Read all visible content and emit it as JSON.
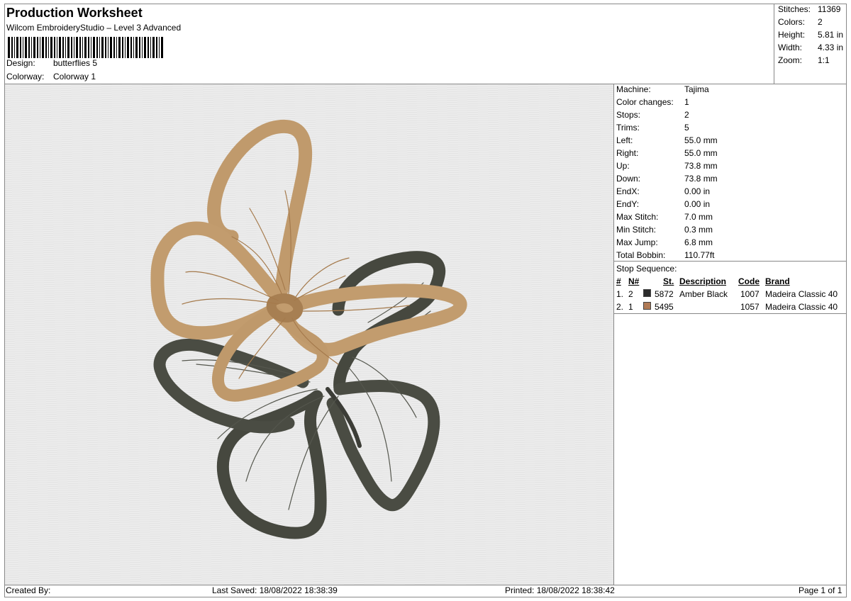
{
  "header": {
    "title": "Production Worksheet",
    "subtitle": "Wilcom EmbroideryStudio – Level 3 Advanced",
    "design_label": "Design:",
    "design_value": "butterflies 5",
    "colorway_label": "Colorway:",
    "colorway_value": "Colorway 1"
  },
  "stats": [
    {
      "label": "Stitches:",
      "value": "11369"
    },
    {
      "label": "Colors:",
      "value": "2"
    },
    {
      "label": "Height:",
      "value": "5.81 in"
    },
    {
      "label": "Width:",
      "value": "4.33 in"
    },
    {
      "label": "Zoom:",
      "value": "1:1"
    }
  ],
  "machine_info": [
    {
      "label": "Machine:",
      "value": "Tajima"
    },
    {
      "label": "Color changes:",
      "value": "1"
    },
    {
      "label": "Stops:",
      "value": "2"
    },
    {
      "label": "Trims:",
      "value": "5"
    },
    {
      "label": "Left:",
      "value": "55.0 mm"
    },
    {
      "label": "Right:",
      "value": "55.0 mm"
    },
    {
      "label": "Up:",
      "value": "73.8 mm"
    },
    {
      "label": "Down:",
      "value": "73.8 mm"
    },
    {
      "label": "EndX:",
      "value": "0.00 in"
    },
    {
      "label": "EndY:",
      "value": "0.00 in"
    },
    {
      "label": "Max Stitch:",
      "value": "7.0 mm"
    },
    {
      "label": "Min Stitch:",
      "value": "0.3 mm"
    },
    {
      "label": "Max Jump:",
      "value": "6.8 mm"
    },
    {
      "label": "Total Bobbin:",
      "value": "110.77ft"
    }
  ],
  "stop_sequence": {
    "title": "Stop Sequence:",
    "headers": {
      "num": "#",
      "n": "N#",
      "st": "St.",
      "description": "Description",
      "code": "Code",
      "brand": "Brand"
    },
    "rows": [
      {
        "num": "1.",
        "n": "2",
        "color": "#2b2b2b",
        "st": "5872",
        "description": "Amber Black",
        "code": "1007",
        "brand": "Madeira Classic 40"
      },
      {
        "num": "2.",
        "n": "1",
        "color": "#b07a55",
        "st": "5495",
        "description": "",
        "code": "1057",
        "brand": "Madeira Classic 40"
      }
    ]
  },
  "footer": {
    "created_by": "Created By:",
    "last_saved": "Last Saved: 18/08/2022 18:38:39",
    "printed": "Printed: 18/08/2022 18:38:42",
    "page": "Page 1 of 1"
  },
  "colors": {
    "dark_thread": "#4a4c45",
    "tan_thread": "#c09a6c",
    "tan_shadow": "#8f6b45"
  }
}
